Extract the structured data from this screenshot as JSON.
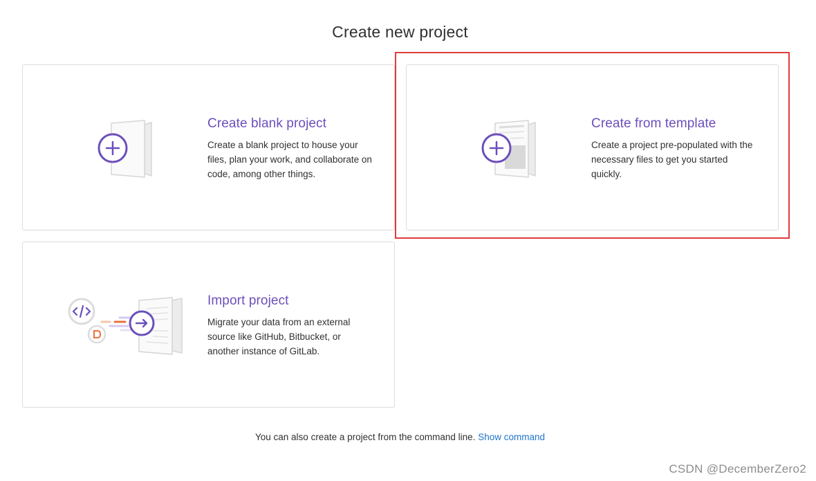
{
  "page": {
    "title": "Create new project"
  },
  "cards": {
    "blank": {
      "title": "Create blank project",
      "description": "Create a blank project to house your files, plan your work, and collaborate on code, among other things.",
      "icon": "plus-document-icon"
    },
    "template": {
      "title": "Create from template",
      "description": "Create a project pre-populated with the necessary files to get you started quickly.",
      "icon": "template-document-icon",
      "highlighted": true
    },
    "import": {
      "title": "Import project",
      "description": "Migrate your data from an external source like GitHub, Bitbucket, or another instance of GitLab.",
      "icon": "import-arrow-icon"
    }
  },
  "footer": {
    "text": "You can also create a project from the command line.",
    "link": "Show command"
  },
  "watermark": "CSDN @DecemberZero2",
  "colors": {
    "accent": "#6b4fbb",
    "link": "#1f75cb",
    "highlight_border": "#e03b3b",
    "import_orange": "#e9733c"
  }
}
